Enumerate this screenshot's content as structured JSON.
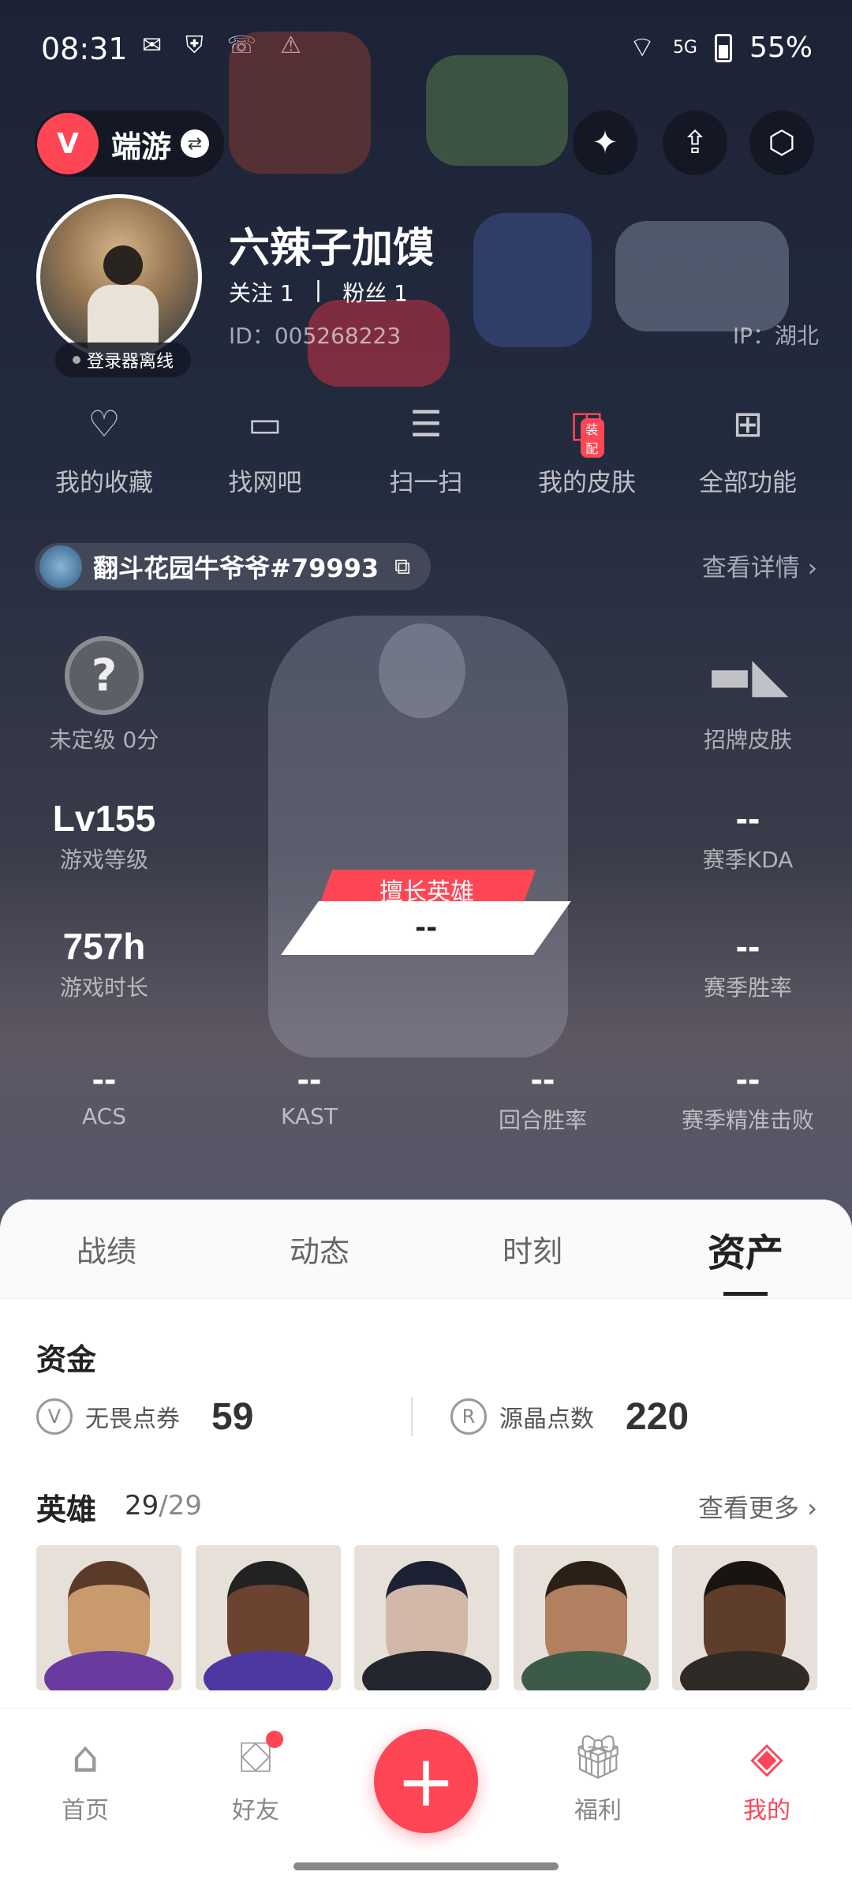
{
  "status_bar": {
    "time": "08:31",
    "battery": "55%",
    "network": "5G"
  },
  "header": {
    "app_name": "端游"
  },
  "profile": {
    "username": "六辣子加馍",
    "follow_label": "关注",
    "follow_count": "1",
    "fans_label": "粉丝",
    "fans_count": "1",
    "id": "ID：005268223",
    "ip": "IP：湖北",
    "status": "登录器离线"
  },
  "features": [
    {
      "label": "我的收藏",
      "icon": "heart-icon"
    },
    {
      "label": "找网吧",
      "icon": "monitor-icon"
    },
    {
      "label": "扫一扫",
      "icon": "scan-icon"
    },
    {
      "label": "我的皮肤",
      "icon": "skin-icon",
      "badge": "装配"
    },
    {
      "label": "全部功能",
      "icon": "grid-icon"
    }
  ],
  "account": {
    "name": "翻斗花园牛爷爷#79993",
    "details_link": "查看详情 ›"
  },
  "stats": {
    "rank": {
      "value": "未定级 0分"
    },
    "signature_skin": {
      "label": "招牌皮肤"
    },
    "level": {
      "value": "Lv155",
      "label": "游戏等级"
    },
    "kda": {
      "value": "--",
      "label": "赛季KDA"
    },
    "playtime": {
      "value": "757h",
      "label": "游戏时长"
    },
    "winrate": {
      "value": "--",
      "label": "赛季胜率"
    },
    "best_hero_tag": "擅长英雄",
    "best_hero_value": "--",
    "acs": {
      "value": "--",
      "label": "ACS"
    },
    "kast": {
      "value": "--",
      "label": "KAST"
    },
    "round_winrate": {
      "value": "--",
      "label": "回合胜率"
    },
    "headshot": {
      "value": "--",
      "label": "赛季精准击败"
    }
  },
  "tabs": [
    "战绩",
    "动态",
    "时刻",
    "资产"
  ],
  "assets": {
    "funds_title": "资金",
    "vp_label": "无畏点券",
    "vp_value": "59",
    "rp_label": "源晶点数",
    "rp_value": "220",
    "heroes_title": "英雄",
    "heroes_owned": "29",
    "heroes_total": "/29",
    "more_link": "查看更多 ›"
  },
  "bottom_nav": [
    {
      "label": "首页",
      "icon": "home-icon"
    },
    {
      "label": "好友",
      "icon": "friends-icon"
    },
    {
      "label": "福利",
      "icon": "gift-icon"
    },
    {
      "label": "我的",
      "icon": "profile-icon"
    }
  ],
  "colors": {
    "accent": "#ff4655",
    "sheet_bg": "#ffffff"
  }
}
